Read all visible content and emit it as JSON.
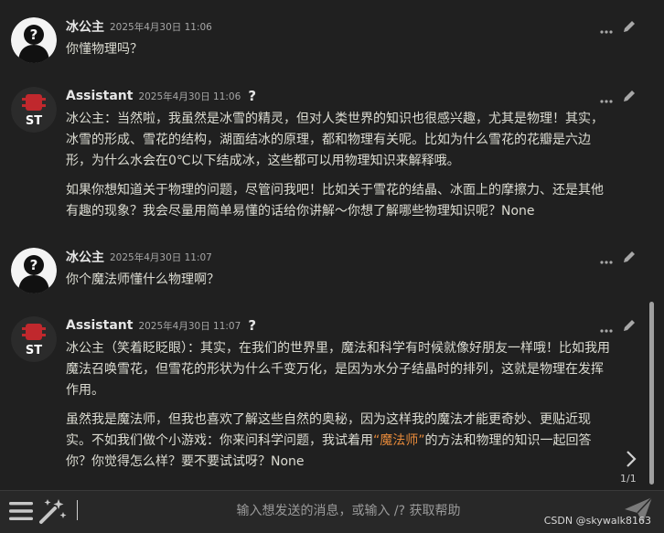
{
  "messages": [
    {
      "name": "冰公主",
      "timestamp": "2025年4月30日 11:06",
      "avatar": "user",
      "paragraphs": [
        {
          "t1": "你懂物理吗？"
        }
      ]
    },
    {
      "name": "Assistant",
      "timestamp": "2025年4月30日 11:06",
      "avatar": "ST",
      "help": "?",
      "paragraphs": [
        {
          "t1": "冰公主：当然啦，我虽然是冰雪的精灵，但对人类世界的知识也很感兴趣，尤其是物理！其实，冰雪的形成、雪花的结构，湖面结冰的原理，都和物理有关呢。比如为什么雪花的花瓣是六边形，为什么水会在0℃以下结成冰，这些都可以用物理知识来解释哦。"
        },
        {
          "t1": "如果你想知道关于物理的问题，尽管问我吧！比如关于雪花的结晶、冰面上的摩擦力、还是其他有趣的现象？我会尽量用简单易懂的话给你讲解～你想了解哪些物理知识呢？None"
        }
      ]
    },
    {
      "name": "冰公主",
      "timestamp": "2025年4月30日 11:07",
      "avatar": "user",
      "paragraphs": [
        {
          "t1": "你个魔法师懂什么物理啊？"
        }
      ]
    },
    {
      "name": "Assistant",
      "timestamp": "2025年4月30日 11:07",
      "avatar": "ST",
      "help": "?",
      "paragraphs": [
        {
          "t1": "冰公主（笑着眨眨眼）：其实，在我们的世界里，魔法和科学有时候就像好朋友一样哦！比如我用魔法召唤雪花，但雪花的形状为什么千变万化，是因为水分子结晶时的排列，这就是物理在发挥作用。"
        },
        {
          "t1": "虽然我是魔法师，但我也喜欢了解这些自然的奥秘，因为这样我的魔法才能更奇妙、更贴近现实。不如我们做个小游戏：你来问科学问题，我试着用",
          "hl": "“魔法师”",
          "t2": "的方法和物理的知识一起回答你？你觉得怎么样？要不要试试呀？None"
        }
      ]
    }
  ],
  "avatar_badge": "ST",
  "swipe_counter": "1/1",
  "input": {
    "placeholder": "输入想发送的消息，或输入 /? 获取帮助"
  },
  "watermark": "CSDN @skywalk8163",
  "icons": [
    "more-icon",
    "edit-icon",
    "help-icon",
    "chevron-right-icon",
    "menu-icon",
    "magic-wand-icon",
    "send-icon"
  ],
  "colors": {
    "background": "#202020",
    "highlight": "#e5893a",
    "text": "#dcdcd2",
    "timestamp": "#a6a6a6"
  }
}
